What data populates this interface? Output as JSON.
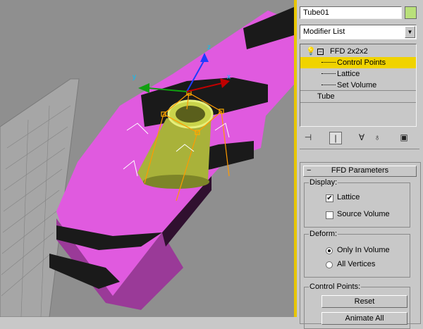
{
  "object_name": "Tube01",
  "object_color": "#b9e07a",
  "modifier_list": {
    "label": "Modifier List",
    "icon": "dropdown-arrow-icon"
  },
  "stack": {
    "items": [
      {
        "label": "FFD 2x2x2",
        "icons": [
          "lightbulb-icon",
          "collapse-minus-icon"
        ]
      },
      {
        "label": "Control Points",
        "selected": true
      },
      {
        "label": "Lattice"
      },
      {
        "label": "Set Volume"
      },
      {
        "label": "Tube"
      }
    ]
  },
  "toolbar": [
    "pin-stack-icon",
    "show-end-result-icon",
    "make-unique-icon",
    "remove-modifier-icon",
    "configure-sets-icon"
  ],
  "rollout": {
    "title": "FFD Parameters",
    "display": {
      "title": "Display:",
      "lattice": {
        "label": "Lattice",
        "checked": true
      },
      "source_volume": {
        "label": "Source Volume",
        "checked": false
      }
    },
    "deform": {
      "title": "Deform:",
      "only_in_volume": {
        "label": "Only In Volume",
        "selected": true
      },
      "all_vertices": {
        "label": "All Vertices",
        "selected": false
      }
    },
    "control_points": {
      "title": "Control Points:",
      "reset": "Reset",
      "animate_all": "Animate All"
    }
  },
  "gizmo": {
    "x": "x",
    "y": "y",
    "z": "z"
  },
  "colors": {
    "accent": "#f0d300",
    "object_pink": "#e05adf",
    "tube": "#b5c23a"
  }
}
